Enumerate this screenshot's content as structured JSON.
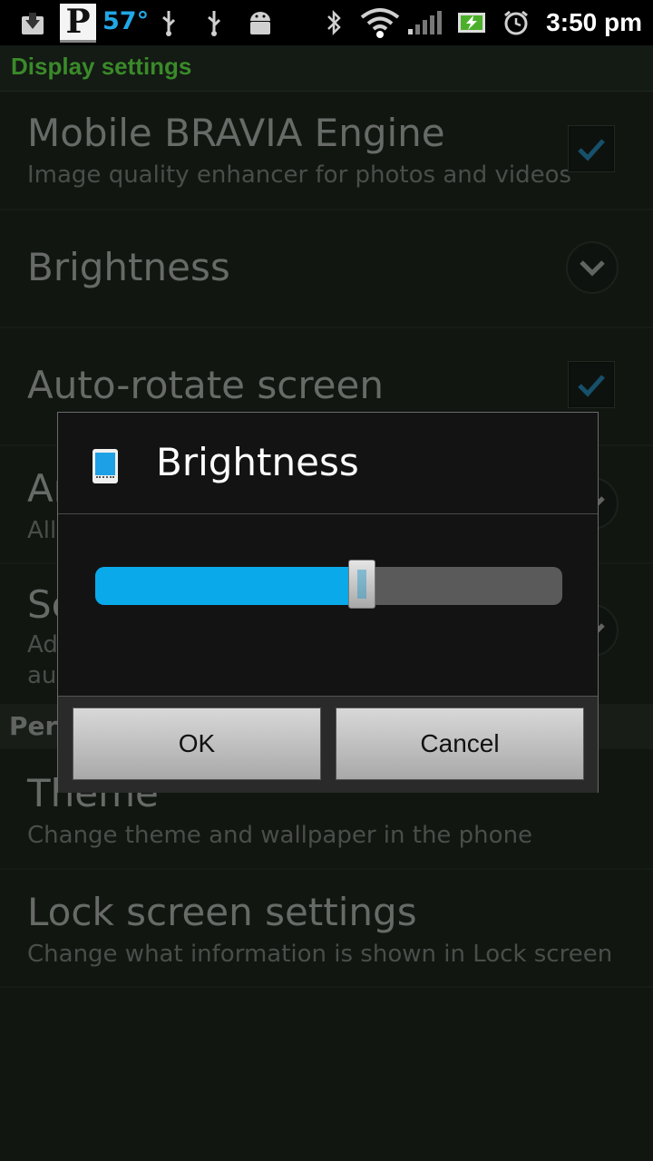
{
  "status_bar": {
    "icons": [
      "download-icon",
      "pandora-icon",
      "usb-icon",
      "usb-icon",
      "android-icon",
      "bluetooth-icon",
      "wifi-icon",
      "signal-icon",
      "battery-icon",
      "alarm-icon"
    ],
    "pandora_letter": "P",
    "temperature": "57°",
    "time": "3:50 pm"
  },
  "screen": {
    "section_title": "Display settings",
    "preferences": [
      {
        "title": "Mobile BRAVIA Engine",
        "summary": "Image quality enhancer for photos and videos",
        "control": "checkbox",
        "checked": true
      },
      {
        "title": "Brightness",
        "summary": "",
        "control": "chevron"
      },
      {
        "title": "Auto-rotate screen",
        "summary": "",
        "control": "checkbox",
        "checked": true
      },
      {
        "title": "Ar",
        "summary": "All",
        "control": "chevron"
      },
      {
        "title": "Sc",
        "summary": "Ad",
        "summary2": "aut",
        "control": "chevron"
      },
      {
        "title": "Theme",
        "summary": "Change theme and wallpaper in the phone"
      },
      {
        "title": "Lock screen settings",
        "summary": "Change what information is shown in Lock screen"
      }
    ],
    "category_header": "Pers"
  },
  "dialog": {
    "title": "Brightness",
    "icon": "phone-icon",
    "slider_value": 0.57,
    "accent_color": "#0aa9ea",
    "ok_label": "OK",
    "cancel_label": "Cancel"
  }
}
